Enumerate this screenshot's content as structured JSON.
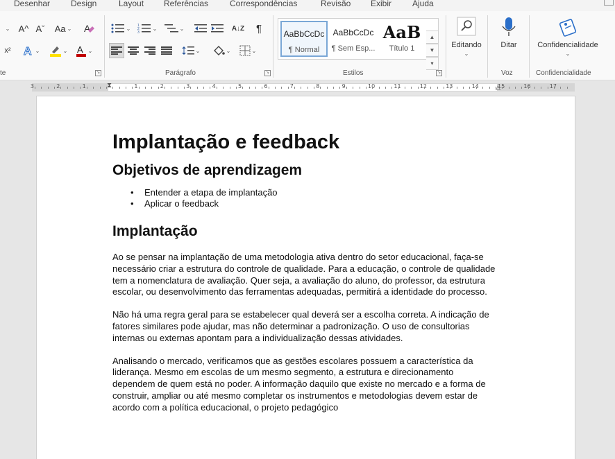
{
  "tabs": [
    "Desenhar",
    "Design",
    "Layout",
    "Referências",
    "Correspondências",
    "Revisão",
    "Exibir",
    "Ajuda"
  ],
  "ribbon": {
    "font_partial_label": "te",
    "paragraph_label": "Parágrafo",
    "styles_label": "Estilos",
    "voice_label": "Voz",
    "confidentiality_label": "Confidencialidade",
    "styles": [
      {
        "preview": "AaBbCcDc",
        "name": "¶ Normal"
      },
      {
        "preview": "AaBbCcDc",
        "name": "¶ Sem Esp..."
      },
      {
        "preview": "AaB",
        "name": "Título 1"
      }
    ],
    "editing_label": "Editando",
    "dictate_label": "Ditar",
    "sensitivity_label": "Confidencialidade",
    "font_case": "Aa",
    "grow_font": "A^",
    "shrink_font": "Aˇ",
    "superscript": "x²",
    "pilcrow": "¶",
    "sort": "A↓Z"
  },
  "ruler_numbers": [
    "3",
    "2",
    "1",
    "1",
    "2",
    "3",
    "4",
    "5",
    "6",
    "7",
    "8",
    "9",
    "10",
    "11",
    "12",
    "13",
    "14",
    "15",
    "16",
    "17"
  ],
  "document": {
    "title": "Implantação e feedback",
    "section1": "Objetivos de aprendizagem",
    "bullets": [
      "Entender a etapa de implantação",
      "Aplicar o feedback"
    ],
    "section2": "Implantação",
    "paragraphs": [
      "Ao se pensar na implantação de uma metodologia ativa dentro do setor educacional, faça-se necessário criar a estrutura do controle de qualidade. Para a educação, o controle de qualidade tem a nomenclatura de avaliação. Quer seja, a avaliação do aluno, do professor, da estrutura escolar, ou desenvolvimento das ferramentas adequadas, permitirá a identidade do processo.",
      "Não há uma regra geral para se estabelecer qual deverá ser a escolha correta. A indicação de fatores similares pode ajudar, mas não determinar a padronização. O uso de consultorias internas ou externas apontam para a individualização dessas atividades.",
      "Analisando o mercado, verificamos que as gestões escolares possuem a característica da liderança. Mesmo em escolas de um mesmo segmento, a estrutura e direcionamento dependem de quem está no poder. A informação daquilo que existe no mercado e a forma de construir, ampliar ou até mesmo completar os instrumentos e metodologias devem estar de acordo com a política educacional, o projeto pedagógico"
    ]
  },
  "colors": {
    "highlight": "#ffe100",
    "font_color": "#c00000",
    "text_effect": "#2b6fc9",
    "accent": "#2b579a"
  }
}
